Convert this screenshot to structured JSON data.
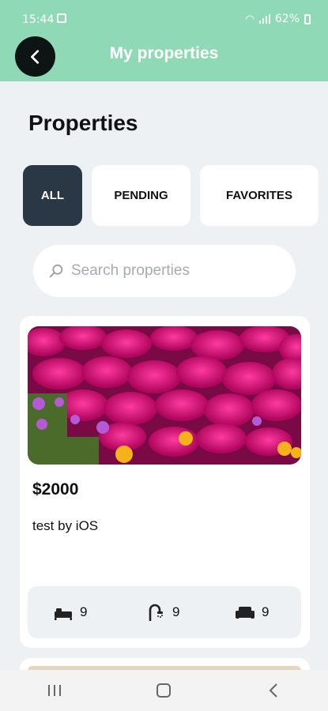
{
  "status_bar": {
    "time": "15:44",
    "battery": "62%"
  },
  "header": {
    "title": "My properties",
    "background": "#8fd9b6"
  },
  "page": {
    "title": "Properties"
  },
  "tabs": [
    {
      "label": "ALL",
      "active": true
    },
    {
      "label": "PENDING",
      "active": false
    },
    {
      "label": "FAVORITES",
      "active": false
    }
  ],
  "search": {
    "placeholder": "Search properties",
    "value": ""
  },
  "listings": [
    {
      "price": "$2000",
      "description": "test by iOS",
      "bedrooms": "9",
      "bathrooms": "9",
      "living_rooms": "9",
      "image": "pink-flowers-photo"
    }
  ],
  "icons": {
    "back": "arrow-left-icon",
    "search": "search-icon",
    "bed": "bed-icon",
    "shower": "shower-icon",
    "sofa": "sofa-icon"
  },
  "colors": {
    "active_tab": "#2a3745",
    "background": "#eef1f4"
  }
}
